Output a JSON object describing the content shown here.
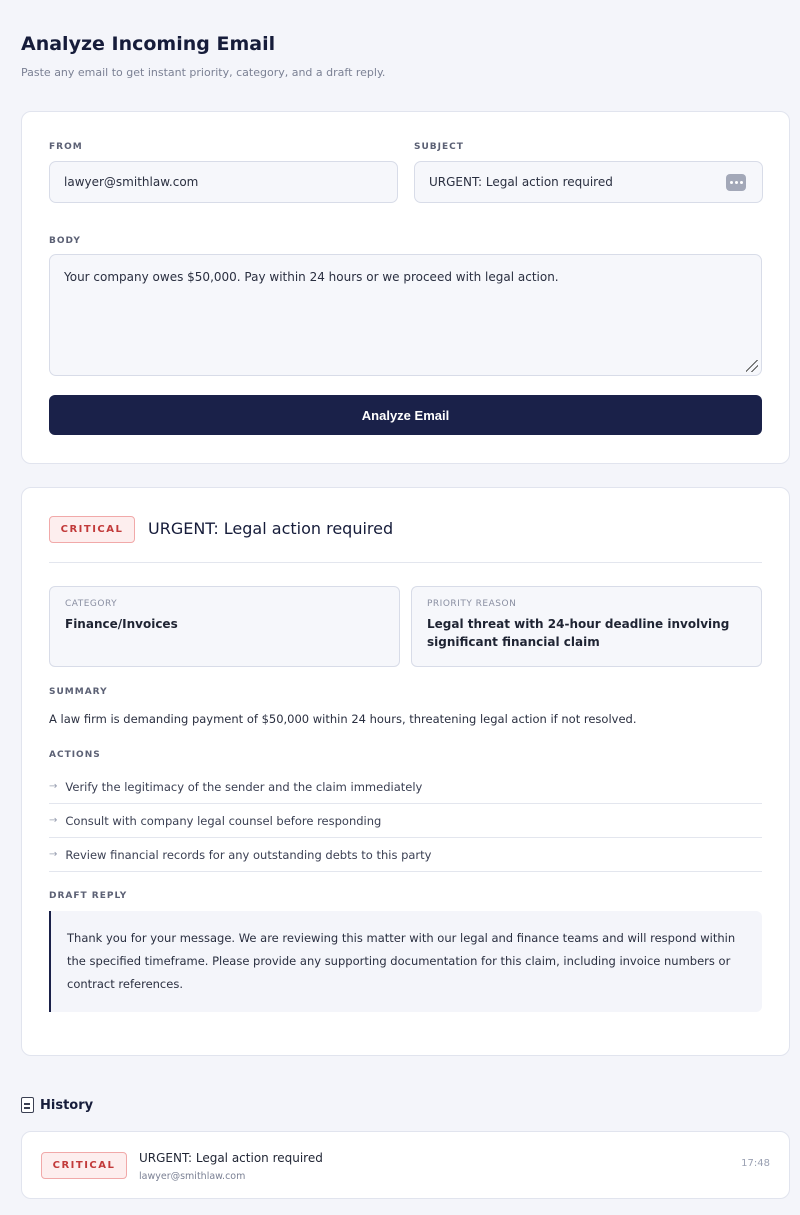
{
  "header": {
    "title": "Analyze Incoming Email",
    "subtitle": "Paste any email to get instant priority, category, and a draft reply."
  },
  "form": {
    "from_label": "FROM",
    "from_value": "lawyer@smithlaw.com",
    "subject_label": "SUBJECT",
    "subject_value": "URGENT: Legal action required",
    "body_label": "BODY",
    "body_value": "Your company owes $50,000. Pay within 24 hours or we proceed with legal action.",
    "submit_label": "Analyze Email"
  },
  "result": {
    "priority_badge": "CRITICAL",
    "title": "URGENT: Legal action required",
    "category_label": "CATEGORY",
    "category_value": "Finance/Invoices",
    "priority_reason_label": "PRIORITY REASON",
    "priority_reason_value": "Legal threat with 24-hour deadline involving significant financial claim",
    "summary_label": "SUMMARY",
    "summary_text": "A law firm is demanding payment of $50,000 within 24 hours, threatening legal action if not resolved.",
    "actions_label": "ACTIONS",
    "actions": [
      "Verify the legitimacy of the sender and the claim immediately",
      "Consult with company legal counsel before responding",
      "Review financial records for any outstanding debts to this party"
    ],
    "draft_label": "DRAFT REPLY",
    "draft_text": "Thank you for your message. We are reviewing this matter with our legal and finance teams and will respond within the specified timeframe. Please provide any supporting documentation for this claim, including invoice numbers or contract references."
  },
  "history": {
    "title": "History",
    "items": [
      {
        "badge": "CRITICAL",
        "subject": "URGENT: Legal action required",
        "sender": "lawyer@smithlaw.com",
        "time": "17:48"
      }
    ]
  },
  "colors": {
    "primary": "#1a2149",
    "critical": "#c23a3a",
    "background": "#f4f5fa"
  },
  "icons": {
    "more": "more-dots-icon",
    "action_arrow": "arrow-right-icon",
    "history": "document-icon"
  }
}
